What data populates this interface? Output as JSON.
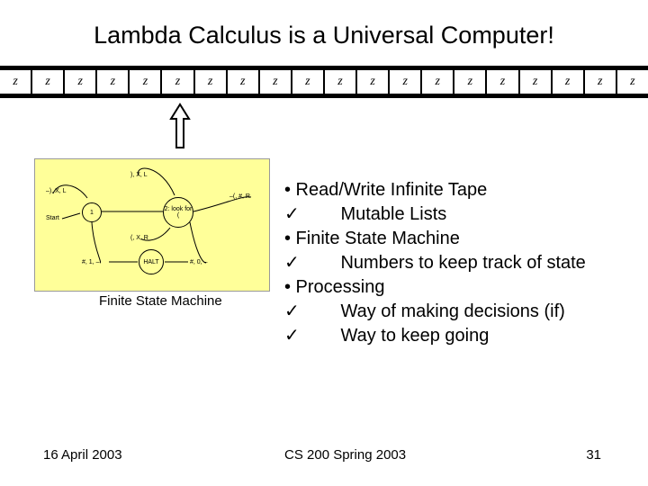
{
  "title": "Lambda Calculus is a Universal Computer!",
  "tape": {
    "cell_symbol": "z",
    "cell_count": 20
  },
  "fsm": {
    "caption": "Finite State Machine",
    "start_label": "Start",
    "states": {
      "s1": "1",
      "s2": "2: look for (",
      "halt": "HALT"
    },
    "transitions": {
      "t_top_left": "–), X, L",
      "t_top_mid": "), X, L",
      "t_mid": "(, X, R",
      "t_right": "–(, #, R",
      "t_bot_left": "#, 1, –",
      "t_bot_right": "#, 0, –"
    }
  },
  "bullets": {
    "l1": "• Read/Write Infinite Tape",
    "l2_check": "✓",
    "l2_text": "        Mutable Lists",
    "l3": "• Finite State Machine",
    "l4_check": "✓",
    "l4_text": "        Numbers to keep track of state",
    "l5": "• Processing",
    "l6_check": "✓",
    "l6_text": "        Way of making decisions (if)",
    "l7_check": "✓",
    "l7_text": "        Way to keep going"
  },
  "footer": {
    "date": "16 April 2003",
    "course": "CS 200 Spring 2003",
    "page": "31"
  }
}
